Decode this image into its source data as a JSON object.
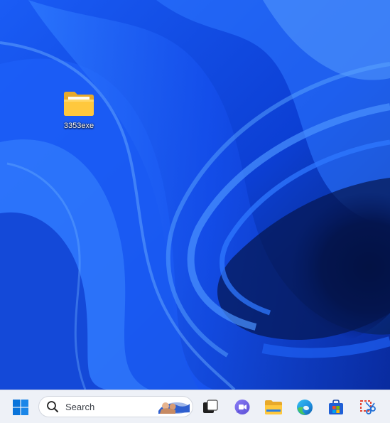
{
  "desktop": {
    "icons": [
      {
        "label": "3353exe",
        "icon": "folder-icon"
      }
    ]
  },
  "taskbar": {
    "search": {
      "placeholder": "Search"
    },
    "buttons": [
      {
        "icon": "windows-logo-icon"
      },
      {
        "icon": "task-view-icon"
      },
      {
        "icon": "chat-icon"
      },
      {
        "icon": "file-explorer-icon"
      },
      {
        "icon": "edge-browser-icon"
      },
      {
        "icon": "microsoft-store-icon"
      },
      {
        "icon": "snipping-tool-icon"
      }
    ]
  },
  "colors": {
    "wallpaper_base": "#0b3fd6",
    "taskbar_bg": "#eef1f7",
    "accent": "#0067c0"
  }
}
